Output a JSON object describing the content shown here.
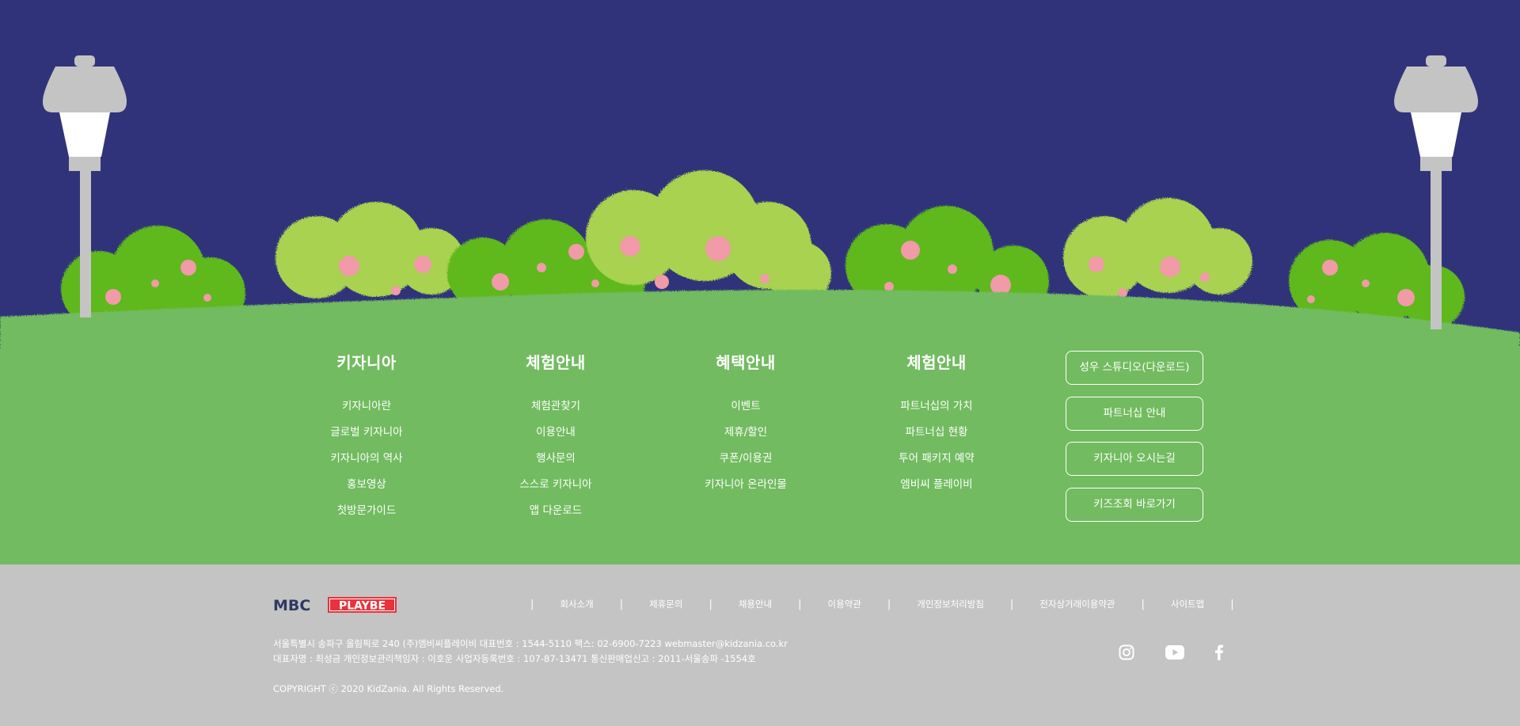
{
  "columns": [
    {
      "title": "키자니아",
      "items": [
        "키자니아란",
        "글로벌 키자니아",
        "키자니아의 역사",
        "홍보영상",
        "첫방문가이드"
      ]
    },
    {
      "title": "체험안내",
      "items": [
        "체험관찾기",
        "이용안내",
        "행사문의",
        "스스로 키자니아",
        "앱 다운로드"
      ]
    },
    {
      "title": "혜택안내",
      "items": [
        "이벤트",
        "제휴/할인",
        "쿠폰/이용권",
        "키자니아 온라인몰"
      ]
    },
    {
      "title": "체험안내",
      "items": [
        "파트너십의 가치",
        "파트너십 현황",
        "투어 패키지 예약",
        "엠비씨 플레이비"
      ]
    }
  ],
  "buttons": [
    "성우 스튜디오(다운로드)",
    "파트너십 안내",
    "키자니아 오시는길",
    "키즈조회 바로가기"
  ],
  "footer": {
    "logo_left": "MBC",
    "logo_right": "PLAYBE",
    "links": [
      "회사소개",
      "제휴문의",
      "채용안내",
      "이용약관",
      "개인정보처리방침",
      "전자상거래이용약관",
      "사이트맵"
    ],
    "info_line1": "서울특별시 송파구 올림픽로 240 (주)엠비씨플레이비 대표번호 : 1544-5110 팩스: 02-6900-7223 webmaster@kidzania.co.kr",
    "info_line2": "대표자명 : 최성금 개인정보관리책임자 : 이호운 사업자등록번호 : 107-87-13471 통신판매업신고 : 2011-서울송파 -1554호",
    "copyright": "COPYRIGHT ⓒ 2020 KidZania. All Rights Reserved.",
    "social": [
      "instagram-icon",
      "youtube-icon",
      "facebook-icon"
    ]
  },
  "colors": {
    "sky": "#31337a",
    "grass": "#72bb60",
    "bush_dark": "#5fb81e",
    "bush_light": "#a8d24f",
    "flower": "#f19aa8",
    "footer_bg": "#c4c4c4",
    "lamp": "#c4c4c4",
    "logo_red": "#e8323c",
    "logo_navy": "#2f3a63"
  }
}
